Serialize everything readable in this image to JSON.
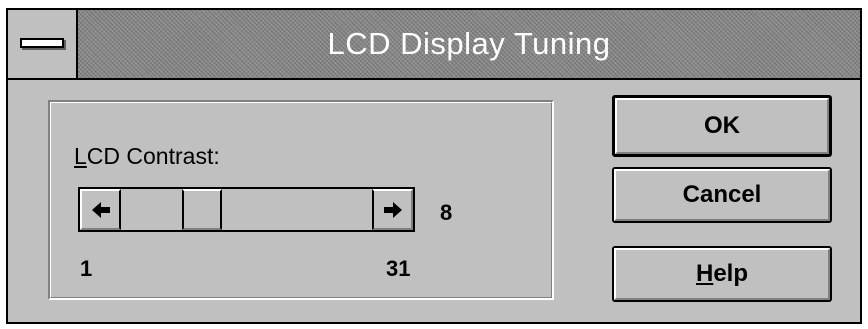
{
  "window": {
    "title": "LCD Display Tuning"
  },
  "contrast": {
    "label_accel": "L",
    "label_rest": "CD Contrast:",
    "value": "8",
    "min": "1",
    "max": "31",
    "level": 8
  },
  "buttons": {
    "ok": "OK",
    "cancel": "Cancel",
    "help_accel": "H",
    "help_rest": "elp"
  },
  "icons": {
    "system_menu": "system-menu-icon",
    "scroll_left": "left-arrow-icon",
    "scroll_right": "right-arrow-icon"
  }
}
